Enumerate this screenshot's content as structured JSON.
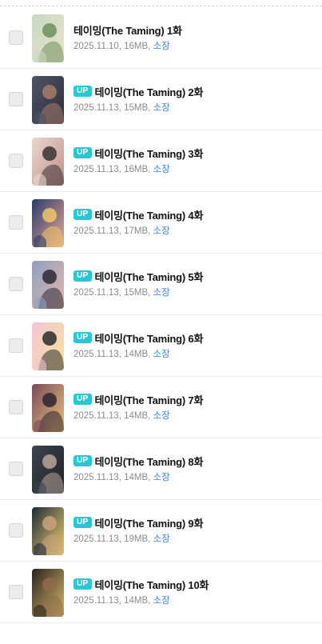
{
  "colors": {
    "up_badge_bg": "#2bc6d4",
    "link": "#3b82d6",
    "meta_text": "#8a8a8a",
    "title_text": "#111111"
  },
  "episodes": [
    {
      "title": "테이밍(The Taming) 1화",
      "up": false,
      "badge": "",
      "date": "2025.11.10",
      "size": "16MB",
      "link": "소장",
      "cover_palette": [
        "#c7d9bf",
        "#e9e3cf",
        "#6f8f5a"
      ]
    },
    {
      "title": "테이밍(The Taming) 2화",
      "up": true,
      "badge": "UP",
      "date": "2025.11.13",
      "size": "15MB",
      "link": "소장",
      "cover_palette": [
        "#4d5466",
        "#2d2f38",
        "#a87a6b"
      ]
    },
    {
      "title": "테이밍(The Taming) 3화",
      "up": true,
      "badge": "UP",
      "date": "2025.11.13",
      "size": "16MB",
      "link": "소장",
      "cover_palette": [
        "#e9d8cf",
        "#c28f8a",
        "#3a3334"
      ]
    },
    {
      "title": "테이밍(The Taming) 4화",
      "up": true,
      "badge": "UP",
      "date": "2025.11.13",
      "size": "17MB",
      "link": "소장",
      "cover_palette": [
        "#2a3b6e",
        "#e6a78f",
        "#f1c66b"
      ]
    },
    {
      "title": "테이밍(The Taming) 5화",
      "up": true,
      "badge": "UP",
      "date": "2025.11.13",
      "size": "15MB",
      "link": "소장",
      "cover_palette": [
        "#8ea0bf",
        "#e4b6ad",
        "#2a2a33"
      ]
    },
    {
      "title": "테이밍(The Taming) 6화",
      "up": true,
      "badge": "UP",
      "date": "2025.11.13",
      "size": "14MB",
      "link": "소장",
      "cover_palette": [
        "#f2c6d6",
        "#f6e39a",
        "#2b2b2b"
      ]
    },
    {
      "title": "테이밍(The Taming) 7화",
      "up": true,
      "badge": "UP",
      "date": "2025.11.13",
      "size": "14MB",
      "link": "소장",
      "cover_palette": [
        "#7a4a5a",
        "#e9c47a",
        "#2f2430"
      ]
    },
    {
      "title": "테이밍(The Taming) 8화",
      "up": true,
      "badge": "UP",
      "date": "2025.11.13",
      "size": "14MB",
      "link": "소장",
      "cover_palette": [
        "#3c4450",
        "#1f2228",
        "#b9a69a"
      ]
    },
    {
      "title": "테이밍(The Taming) 9화",
      "up": true,
      "badge": "UP",
      "date": "2025.11.13",
      "size": "19MB",
      "link": "소장",
      "cover_palette": [
        "#1f2a3a",
        "#f0d06b",
        "#c9a27a"
      ]
    },
    {
      "title": "테이밍(The Taming) 10화",
      "up": true,
      "badge": "UP",
      "date": "2025.11.13",
      "size": "14MB",
      "link": "소장",
      "cover_palette": [
        "#2a2420",
        "#d8b86a",
        "#8f6b4a"
      ]
    }
  ]
}
